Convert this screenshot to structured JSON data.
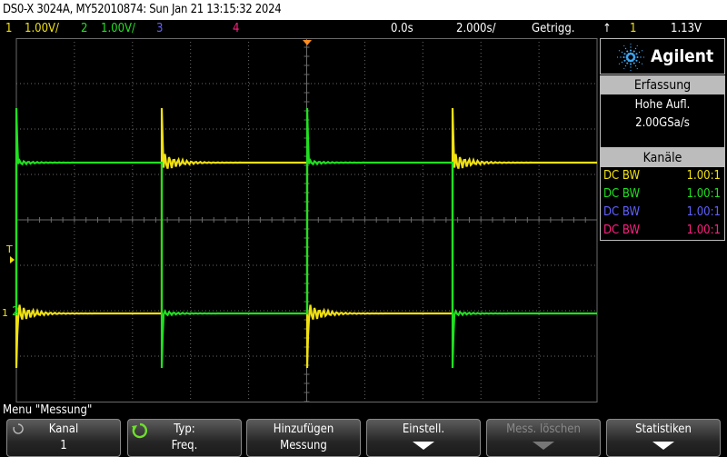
{
  "titlebar": "DS0-X 3024A, MY52010874: Sun Jan 21 13:15:32 2024",
  "status": {
    "ch1_num": "1",
    "ch1_scale": "1.00V/",
    "ch2_num": "2",
    "ch2_scale": "1.00V/",
    "ch3_num": "3",
    "ch4_num": "4",
    "delay": "0.0s",
    "timebase": "2.000s/",
    "mode": "Getrigg.",
    "trig_symbol": "↑",
    "trig_src": "1",
    "trig_level": "1.13V"
  },
  "colors": {
    "ch1": "#f0e010",
    "ch2": "#20e020",
    "ch3": "#6060ff",
    "ch4": "#ff2080",
    "grid": "#6a6a6a"
  },
  "logo": {
    "brand": "Agilent"
  },
  "acquisition": {
    "header": "Erfassung",
    "mode": "Hohe Aufl.",
    "rate": "2.00GSa/s"
  },
  "channels": {
    "header": "Kanäle",
    "rows": [
      {
        "coupling": "DC BW",
        "probe": "1.00:1"
      },
      {
        "coupling": "DC BW",
        "probe": "1.00:1"
      },
      {
        "coupling": "DC BW",
        "probe": "1.00:1"
      },
      {
        "coupling": "DC BW",
        "probe": "1.00:1"
      }
    ]
  },
  "markers": {
    "trigger": "T",
    "ch1": "1",
    "ch2": "2"
  },
  "menu_label": "Menu \"Messung\"",
  "softkeys": [
    {
      "line1": "Kanal",
      "line2": "1"
    },
    {
      "line1": "Typ:",
      "line2": "Freq."
    },
    {
      "line1": "Hinzufügen",
      "line2": "Messung"
    },
    {
      "line1": "Einstell.",
      "line2": ""
    },
    {
      "line1": "Mess. löschen",
      "line2": ""
    },
    {
      "line1": "Statistiken",
      "line2": ""
    }
  ]
}
